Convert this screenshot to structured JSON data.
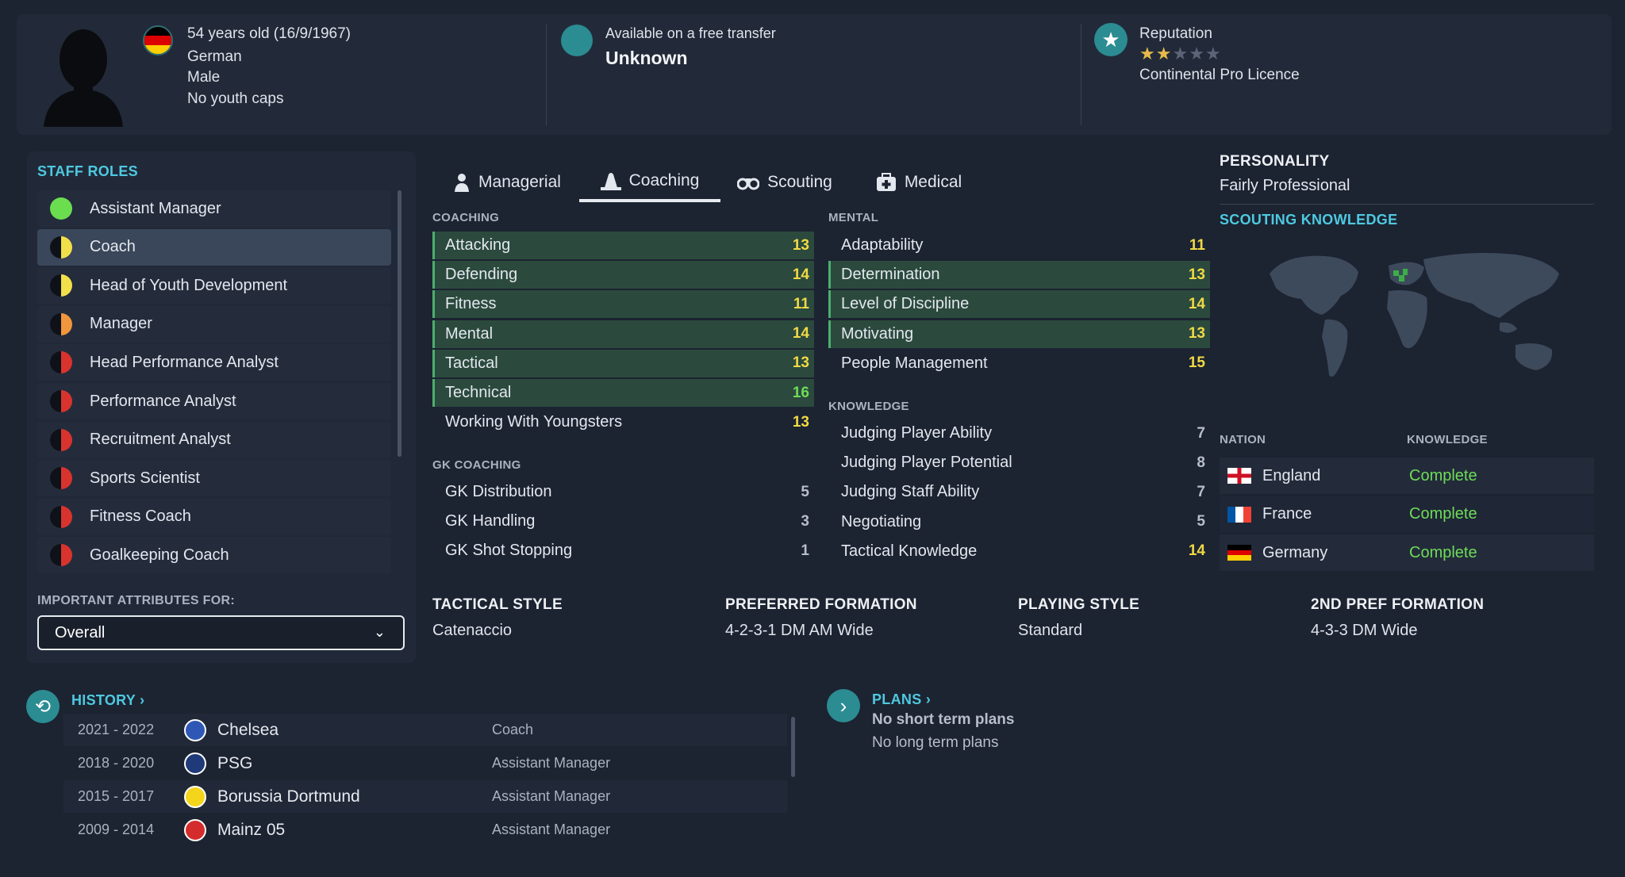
{
  "header": {
    "age_dob": "54 years old (16/9/1967)",
    "nationality": "German",
    "gender": "Male",
    "youth_caps": "No youth caps",
    "transfer_status": "Available on a free transfer",
    "transfer_value": "Unknown",
    "reputation_label": "Reputation",
    "reputation_stars": 2,
    "licence": "Continental Pro Licence"
  },
  "staff_roles": {
    "title": "STAFF ROLES",
    "items": [
      {
        "label": "Assistant Manager",
        "color": "#6bde4f",
        "style": "full"
      },
      {
        "label": "Coach",
        "color": "#f2e04a",
        "style": "half"
      },
      {
        "label": "Head of Youth Development",
        "color": "#f2e04a",
        "style": "half"
      },
      {
        "label": "Manager",
        "color": "#f0963c",
        "style": "half"
      },
      {
        "label": "Head Performance Analyst",
        "color": "#d9332e",
        "style": "half"
      },
      {
        "label": "Performance Analyst",
        "color": "#d9332e",
        "style": "half"
      },
      {
        "label": "Recruitment Analyst",
        "color": "#d9332e",
        "style": "half"
      },
      {
        "label": "Sports Scientist",
        "color": "#d9332e",
        "style": "half"
      },
      {
        "label": "Fitness Coach",
        "color": "#d9332e",
        "style": "half"
      },
      {
        "label": "Goalkeeping Coach",
        "color": "#d9332e",
        "style": "half"
      }
    ],
    "selected_index": 1,
    "important_label": "IMPORTANT ATTRIBUTES FOR:",
    "important_value": "Overall"
  },
  "tabs": [
    {
      "label": "Managerial",
      "icon": "managerial-icon"
    },
    {
      "label": "Coaching",
      "icon": "coaching-icon"
    },
    {
      "label": "Scouting",
      "icon": "binoculars-icon"
    },
    {
      "label": "Medical",
      "icon": "medical-kit-icon"
    }
  ],
  "active_tab": "Coaching",
  "coaching": {
    "title": "COACHING",
    "attrs": [
      {
        "name": "Attacking",
        "value": "13",
        "hl": true
      },
      {
        "name": "Defending",
        "value": "14",
        "hl": true
      },
      {
        "name": "Fitness",
        "value": "11",
        "hl": true
      },
      {
        "name": "Mental",
        "value": "14",
        "hl": true
      },
      {
        "name": "Tactical",
        "value": "13",
        "hl": true
      },
      {
        "name": "Technical",
        "value": "16",
        "hl": true
      },
      {
        "name": "Working With Youngsters",
        "value": "13",
        "hl": false
      }
    ]
  },
  "gk_coaching": {
    "title": "GK COACHING",
    "attrs": [
      {
        "name": "GK Distribution",
        "value": "5"
      },
      {
        "name": "GK Handling",
        "value": "3"
      },
      {
        "name": "GK Shot Stopping",
        "value": "1"
      }
    ]
  },
  "mental": {
    "title": "MENTAL",
    "attrs": [
      {
        "name": "Adaptability",
        "value": "11",
        "hl": false
      },
      {
        "name": "Determination",
        "value": "13",
        "hl": true
      },
      {
        "name": "Level of Discipline",
        "value": "14",
        "hl": true
      },
      {
        "name": "Motivating",
        "value": "13",
        "hl": true
      },
      {
        "name": "People Management",
        "value": "15",
        "hl": false
      }
    ]
  },
  "knowledge": {
    "title": "KNOWLEDGE",
    "attrs": [
      {
        "name": "Judging Player Ability",
        "value": "7"
      },
      {
        "name": "Judging Player Potential",
        "value": "8"
      },
      {
        "name": "Judging Staff Ability",
        "value": "7"
      },
      {
        "name": "Negotiating",
        "value": "5"
      },
      {
        "name": "Tactical Knowledge",
        "value": "14"
      }
    ]
  },
  "style": {
    "tactical_title": "TACTICAL STYLE",
    "tactical_value": "Catenaccio",
    "formation_title": "PREFERRED FORMATION",
    "formation_value": "4-2-3-1 DM AM Wide",
    "playing_title": "PLAYING STYLE",
    "playing_value": "Standard",
    "formation2_title": "2ND PREF FORMATION",
    "formation2_value": "4-3-3 DM Wide"
  },
  "personality": {
    "title": "PERSONALITY",
    "value": "Fairly Professional"
  },
  "scouting": {
    "title": "SCOUTING KNOWLEDGE",
    "nation_header": "NATION",
    "knowledge_header": "KNOWLEDGE",
    "nations": [
      {
        "name": "England",
        "knowledge": "Complete",
        "flag": "england"
      },
      {
        "name": "France",
        "knowledge": "Complete",
        "flag": "france"
      },
      {
        "name": "Germany",
        "knowledge": "Complete",
        "flag": "germany"
      }
    ]
  },
  "history": {
    "title": "HISTORY",
    "rows": [
      {
        "years": "2021 - 2022",
        "club": "Chelsea",
        "role": "Coach",
        "badge_color": "#2f57b6"
      },
      {
        "years": "2018 - 2020",
        "club": "PSG",
        "role": "Assistant Manager",
        "badge_color": "#1f3a78"
      },
      {
        "years": "2015 - 2017",
        "club": "Borussia Dortmund",
        "role": "Assistant Manager",
        "badge_color": "#f5d41c"
      },
      {
        "years": "2009 - 2014",
        "club": "Mainz 05",
        "role": "Assistant Manager",
        "badge_color": "#d42c2c"
      }
    ]
  },
  "plans": {
    "title": "PLANS",
    "short_term": "No short term plans",
    "long_term": "No long term plans"
  }
}
